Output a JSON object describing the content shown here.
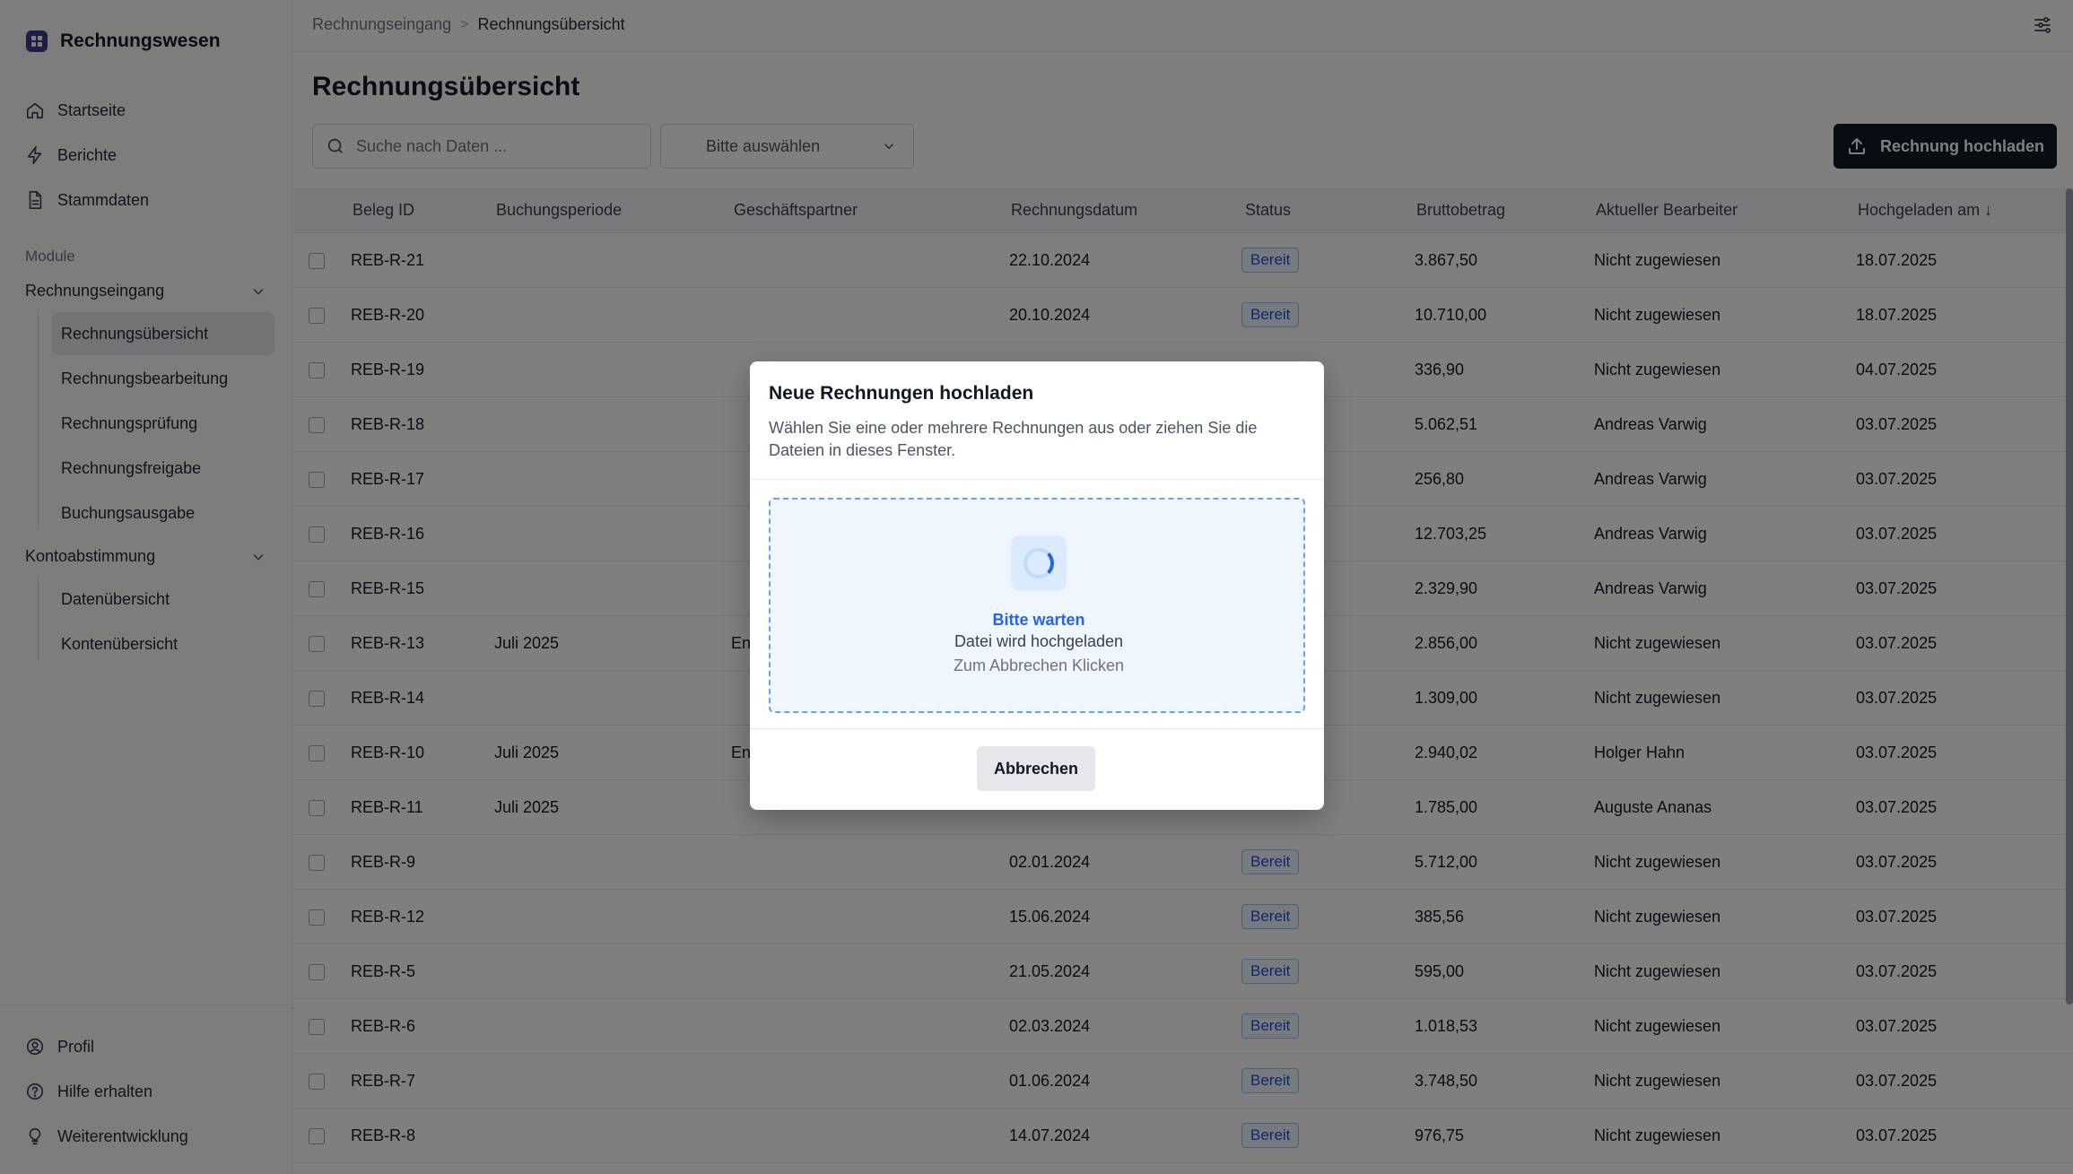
{
  "app": {
    "name": "Rechnungswesen"
  },
  "nav": {
    "main": [
      {
        "label": "Startseite",
        "icon": "home-icon"
      },
      {
        "label": "Berichte",
        "icon": "bolt-icon"
      },
      {
        "label": "Stammdaten",
        "icon": "document-icon"
      }
    ],
    "section_label": "Module",
    "groups": [
      {
        "label": "Rechnungseingang",
        "items": [
          "Rechnungsübersicht",
          "Rechnungsbearbeitung",
          "Rechnungsprüfung",
          "Rechnungsfreigabe",
          "Buchungsausgabe"
        ],
        "active": "Rechnungsübersicht"
      },
      {
        "label": "Kontoabstimmung",
        "items": [
          "Datenübersicht",
          "Kontenübersicht"
        ]
      }
    ],
    "bottom": [
      {
        "label": "Profil",
        "icon": "user-circle-icon"
      },
      {
        "label": "Hilfe erhalten",
        "icon": "help-circle-icon"
      },
      {
        "label": "Weiterentwicklung",
        "icon": "lightbulb-icon"
      }
    ]
  },
  "breadcrumb": {
    "parent": "Rechnungseingang",
    "separator": ">",
    "current": "Rechnungsübersicht"
  },
  "page": {
    "title": "Rechnungsübersicht"
  },
  "toolbar": {
    "search_placeholder": "Suche nach Daten ...",
    "select_value": "Bitte auswählen",
    "upload_label": "Rechnung hochladen"
  },
  "table": {
    "headers": [
      "Beleg ID",
      "Buchungsperiode",
      "Geschäftspartner",
      "Rechnungsdatum",
      "Status",
      "Bruttobetrag",
      "Aktueller Bearbeiter",
      "Hochgeladen am ↓"
    ],
    "rows": [
      {
        "id": "REB-R-21",
        "period": "",
        "partner": "",
        "date": "22.10.2024",
        "status": "Bereit",
        "amount": "3.867,50",
        "assignee": "Nicht zugewiesen",
        "uploaded": "18.07.2025"
      },
      {
        "id": "REB-R-20",
        "period": "",
        "partner": "",
        "date": "20.10.2024",
        "status": "Bereit",
        "amount": "10.710,00",
        "assignee": "Nicht zugewiesen",
        "uploaded": "18.07.2025"
      },
      {
        "id": "REB-R-19",
        "period": "",
        "partner": "",
        "date": "",
        "status": "",
        "amount": "336,90",
        "assignee": "Nicht zugewiesen",
        "uploaded": "04.07.2025"
      },
      {
        "id": "REB-R-18",
        "period": "",
        "partner": "",
        "date": "",
        "status": "",
        "amount": "5.062,51",
        "assignee": "Andreas Varwig",
        "uploaded": "03.07.2025"
      },
      {
        "id": "REB-R-17",
        "period": "",
        "partner": "",
        "date": "",
        "status": "",
        "amount": "256,80",
        "assignee": "Andreas Varwig",
        "uploaded": "03.07.2025"
      },
      {
        "id": "REB-R-16",
        "period": "",
        "partner": "",
        "date": "",
        "status": "",
        "amount": "12.703,25",
        "assignee": "Andreas Varwig",
        "uploaded": "03.07.2025"
      },
      {
        "id": "REB-R-15",
        "period": "",
        "partner": "",
        "date": "",
        "status": "",
        "amount": "2.329,90",
        "assignee": "Andreas Varwig",
        "uploaded": "03.07.2025"
      },
      {
        "id": "REB-R-13",
        "period": "Juli 2025",
        "partner": "En",
        "date": "",
        "status": "",
        "amount": "2.856,00",
        "assignee": "Nicht zugewiesen",
        "uploaded": "03.07.2025"
      },
      {
        "id": "REB-R-14",
        "period": "",
        "partner": "",
        "date": "",
        "status": "",
        "amount": "1.309,00",
        "assignee": "Nicht zugewiesen",
        "uploaded": "03.07.2025"
      },
      {
        "id": "REB-R-10",
        "period": "Juli 2025",
        "partner": "En",
        "date": "",
        "status": "",
        "amount": "2.940,02",
        "assignee": "Holger Hahn",
        "uploaded": "03.07.2025"
      },
      {
        "id": "REB-R-11",
        "period": "Juli 2025",
        "partner": "",
        "date": "",
        "status": "",
        "amount": "1.785,00",
        "assignee": "Auguste Ananas",
        "uploaded": "03.07.2025"
      },
      {
        "id": "REB-R-9",
        "period": "",
        "partner": "",
        "date": "02.01.2024",
        "status": "Bereit",
        "amount": "5.712,00",
        "assignee": "Nicht zugewiesen",
        "uploaded": "03.07.2025"
      },
      {
        "id": "REB-R-12",
        "period": "",
        "partner": "",
        "date": "15.06.2024",
        "status": "Bereit",
        "amount": "385,56",
        "assignee": "Nicht zugewiesen",
        "uploaded": "03.07.2025"
      },
      {
        "id": "REB-R-5",
        "period": "",
        "partner": "",
        "date": "21.05.2024",
        "status": "Bereit",
        "amount": "595,00",
        "assignee": "Nicht zugewiesen",
        "uploaded": "03.07.2025"
      },
      {
        "id": "REB-R-6",
        "period": "",
        "partner": "",
        "date": "02.03.2024",
        "status": "Bereit",
        "amount": "1.018,53",
        "assignee": "Nicht zugewiesen",
        "uploaded": "03.07.2025"
      },
      {
        "id": "REB-R-7",
        "period": "",
        "partner": "",
        "date": "01.06.2024",
        "status": "Bereit",
        "amount": "3.748,50",
        "assignee": "Nicht zugewiesen",
        "uploaded": "03.07.2025"
      },
      {
        "id": "REB-R-8",
        "period": "",
        "partner": "",
        "date": "14.07.2024",
        "status": "Bereit",
        "amount": "976,75",
        "assignee": "Nicht zugewiesen",
        "uploaded": "03.07.2025"
      }
    ]
  },
  "modal": {
    "title": "Neue Rechnungen hochladen",
    "description": "Wählen Sie eine oder mehrere Rechnungen aus oder ziehen Sie die Dateien in dieses Fenster.",
    "dropzone": {
      "title": "Bitte warten",
      "subtitle": "Datei wird hochgeladen",
      "cancel_hint": "Zum Abbrechen Klicken"
    },
    "cancel_label": "Abbrechen"
  },
  "colors": {
    "accent": "#2563eb",
    "primary_button": "#111827",
    "badge_border": "#93c5fd"
  }
}
